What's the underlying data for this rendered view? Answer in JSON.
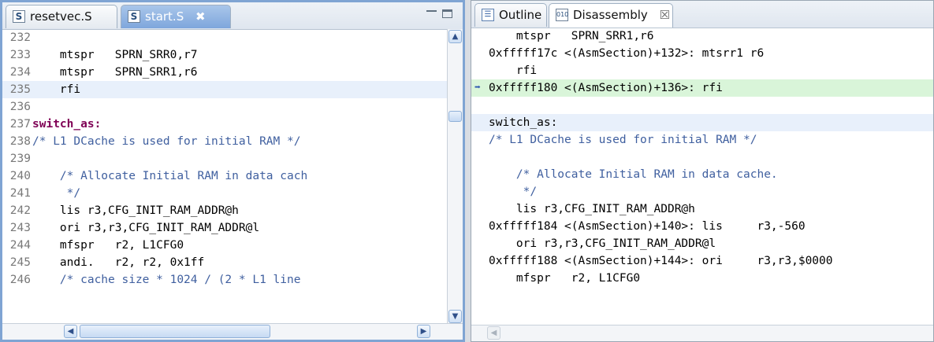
{
  "left_editor": {
    "tabs": [
      {
        "label": "resetvec.S",
        "icon": "asm-source-file-icon"
      },
      {
        "label": "start.S",
        "icon": "asm-source-file-icon",
        "close": "✖"
      }
    ],
    "lines": [
      {
        "num": "232",
        "text": ""
      },
      {
        "num": "233",
        "text": "    mtspr   SPRN_SRR0,r7"
      },
      {
        "num": "234",
        "text": "    mtspr   SPRN_SRR1,r6"
      },
      {
        "num": "235",
        "text": "    rfi"
      },
      {
        "num": "236",
        "text": ""
      },
      {
        "num": "237",
        "text": "switch_as:"
      },
      {
        "num": "238",
        "text": "/* L1 DCache is used for initial RAM */"
      },
      {
        "num": "239",
        "text": ""
      },
      {
        "num": "240",
        "text": "    /* Allocate Initial RAM in data cach"
      },
      {
        "num": "241",
        "text": "     */"
      },
      {
        "num": "242",
        "text": "    lis r3,CFG_INIT_RAM_ADDR@h"
      },
      {
        "num": "243",
        "text": "    ori r3,r3,CFG_INIT_RAM_ADDR@l"
      },
      {
        "num": "244",
        "text": "    mfspr   r2, L1CFG0"
      },
      {
        "num": "245",
        "text": "    andi.   r2, r2, 0x1ff"
      },
      {
        "num": "246",
        "text": "    /* cache size * 1024 / (2 * L1 line"
      }
    ]
  },
  "right_view": {
    "tabs": [
      {
        "label": "Outline",
        "icon": "outline-icon"
      },
      {
        "label": "Disassembly",
        "icon": "disassembly-icon",
        "close": "☒"
      }
    ],
    "lines": [
      {
        "text": "    mtspr   SPRN_SRR1,r6"
      },
      {
        "text": "0xfffff17c <(AsmSection)+132>: mtsrr1 r6"
      },
      {
        "text": "    rfi"
      },
      {
        "text": "0xfffff180 <(AsmSection)+136>: rfi"
      },
      {
        "text": ""
      },
      {
        "text": "switch_as:"
      },
      {
        "text": "/* L1 DCache is used for initial RAM */"
      },
      {
        "text": ""
      },
      {
        "text": "    /* Allocate Initial RAM in data cache."
      },
      {
        "text": "     */"
      },
      {
        "text": "    lis r3,CFG_INIT_RAM_ADDR@h"
      },
      {
        "text": "0xfffff184 <(AsmSection)+140>: lis     r3,-560"
      },
      {
        "text": "    ori r3,r3,CFG_INIT_RAM_ADDR@l"
      },
      {
        "text": "0xfffff188 <(AsmSection)+144>: ori     r3,r3,$0000"
      },
      {
        "text": "    mfspr   r2, L1CFG0"
      }
    ]
  },
  "colors": {
    "accent": "#7fa4d3",
    "current_line": "#e8f0fb",
    "pc_line": "#d9f5d9",
    "label": "#7f0055",
    "comment": "#3f5f9f"
  }
}
